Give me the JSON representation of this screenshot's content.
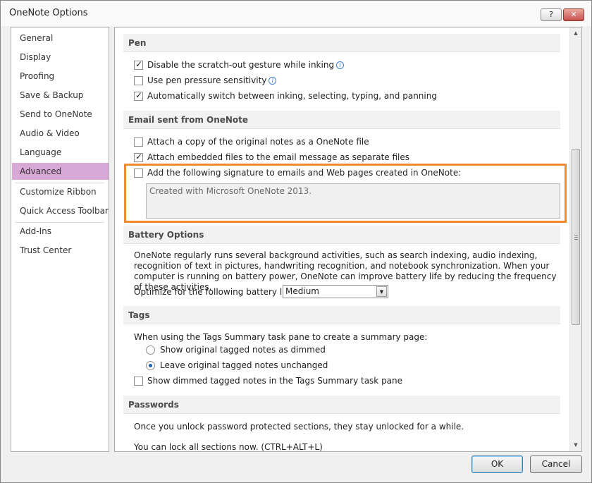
{
  "window": {
    "title": "OneNote Options",
    "help_label": "?",
    "close_label": "✕"
  },
  "sidebar": {
    "items": [
      {
        "label": "General"
      },
      {
        "label": "Display"
      },
      {
        "label": "Proofing"
      },
      {
        "label": "Save & Backup"
      },
      {
        "label": "Send to OneNote"
      },
      {
        "label": "Audio & Video"
      },
      {
        "label": "Language"
      },
      {
        "label": "Advanced",
        "selected": true
      },
      {
        "label": "Customize Ribbon"
      },
      {
        "label": "Quick Access Toolbar"
      },
      {
        "label": "Add-Ins"
      },
      {
        "label": "Trust Center"
      }
    ]
  },
  "pen": {
    "header": "Pen",
    "options": [
      {
        "label": "Disable the scratch-out gesture while inking",
        "checked": true,
        "info": true
      },
      {
        "label": "Use pen pressure sensitivity",
        "checked": false,
        "info": true
      },
      {
        "label": "Automatically switch between inking, selecting, typing, and panning",
        "checked": true,
        "info": false
      }
    ]
  },
  "email": {
    "header": "Email sent from OneNote",
    "options": [
      {
        "label": "Attach a copy of the original notes as a OneNote file",
        "checked": false
      },
      {
        "label": "Attach embedded files to the email message as separate files",
        "checked": true
      },
      {
        "label": "Add the following signature to emails and Web pages created in OneNote:",
        "checked": false
      }
    ],
    "signature_value": "Created with Microsoft OneNote 2013."
  },
  "battery": {
    "header": "Battery Options",
    "description": "OneNote regularly runs several background activities, such as search indexing, audio indexing, recognition of text in pictures, handwriting recognition, and notebook synchronization. When your computer is running on battery power, OneNote can improve battery life by reducing the frequency of these activities.",
    "optimize_label": "Optimize for the following battery life:",
    "optimize_value": "Medium"
  },
  "tags": {
    "header": "Tags",
    "intro": "When using the Tags Summary task pane to create a summary page:",
    "radios": [
      {
        "label": "Show original tagged notes as dimmed",
        "checked": false
      },
      {
        "label": "Leave original tagged notes unchanged",
        "checked": true
      }
    ],
    "dimmed_checkbox": {
      "label": "Show dimmed tagged notes in the Tags Summary task pane",
      "checked": false
    }
  },
  "passwords": {
    "header": "Passwords",
    "line1": "Once you unlock password protected sections, they stay unlocked for a while.",
    "line2": "You can lock all sections now. (CTRL+ALT+L)"
  },
  "footer": {
    "ok_label": "OK",
    "cancel_label": "Cancel"
  },
  "colors": {
    "highlight": "#f08a2c",
    "selected_nav": "#d8a9d6"
  }
}
